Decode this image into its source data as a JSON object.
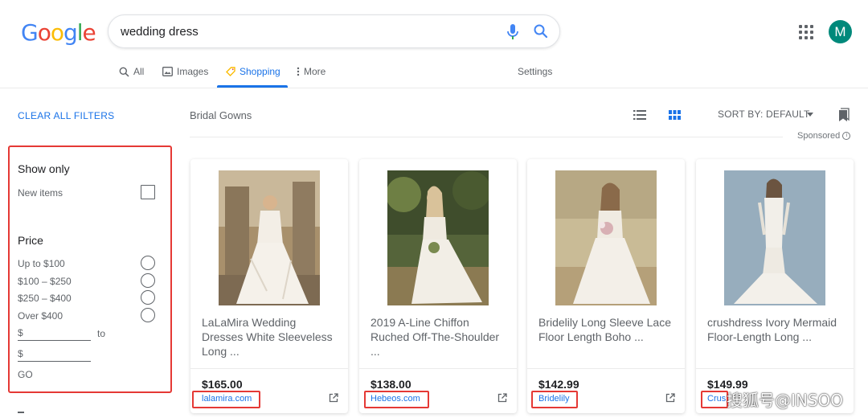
{
  "logo": "Google",
  "logo_colors": [
    "#4285F4",
    "#EA4335",
    "#FBBC05",
    "#4285F4",
    "#34A853",
    "#EA4335"
  ],
  "search": {
    "query": "wedding dress"
  },
  "account": {
    "initial": "M",
    "color": "#00897b"
  },
  "tabs": [
    {
      "label": "All",
      "icon": "search-icon",
      "active": false
    },
    {
      "label": "Images",
      "icon": "image-icon",
      "active": false
    },
    {
      "label": "Shopping",
      "icon": "tag-icon",
      "active": true
    },
    {
      "label": "More",
      "icon": "more-vert-icon",
      "active": false
    }
  ],
  "settings_label": "Settings",
  "filters": {
    "clear_all": "CLEAR ALL FILTERS",
    "show_only": {
      "heading": "Show only",
      "new_items": "New items"
    },
    "price": {
      "heading": "Price",
      "options": [
        "Up to $100",
        "$100 – $250",
        "$250 – $400",
        "Over $400"
      ],
      "min_prefix": "$",
      "to": "to",
      "max_prefix": "$",
      "go": "GO"
    }
  },
  "results": {
    "category": "Bridal Gowns",
    "sort_label": "SORT BY: DEFAULT",
    "sponsored": "Sponsored",
    "products": [
      {
        "title": "LaLaMira Wedding Dresses White Sleeveless Long ...",
        "price": "$165.00",
        "store": "lalamira.com"
      },
      {
        "title": "2019 A-Line Chiffon Ruched Off-The-Shoulder ...",
        "price": "$138.00",
        "store": "Hebeos.com"
      },
      {
        "title": "Bridelily Long Sleeve Lace Floor Length Boho ...",
        "price": "$142.99",
        "store": "Bridelily"
      },
      {
        "title": "crushdress Ivory Mermaid Floor-Length Long ...",
        "price": "$149.99",
        "store": "Crus"
      }
    ]
  },
  "highlight_color": "#e53935",
  "accent_color": "#1a73e8",
  "watermark": "搜狐号@INSOO"
}
